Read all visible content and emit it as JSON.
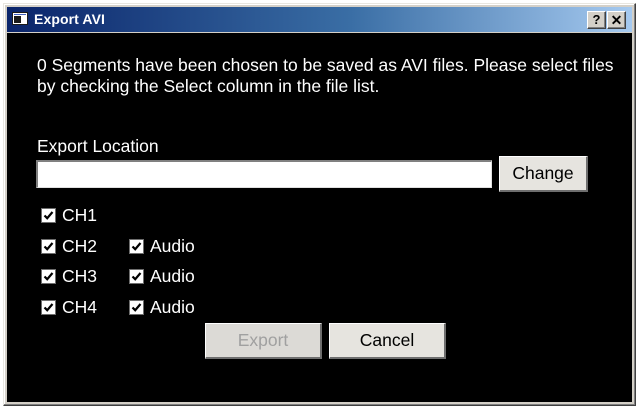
{
  "window": {
    "title": "Export AVI",
    "help_button": "?",
    "close_button": "✕"
  },
  "message": "0 Segments have been chosen to be saved as AVI files. Please select files by checking the Select column in the file list.",
  "export_location": {
    "label": "Export Location",
    "value": "",
    "change_label": "Change"
  },
  "channels": [
    {
      "label": "CH1",
      "checked": true
    },
    {
      "label": "CH2",
      "checked": true,
      "audio_label": "Audio",
      "audio_checked": true
    },
    {
      "label": "CH3",
      "checked": true,
      "audio_label": "Audio",
      "audio_checked": true
    },
    {
      "label": "CH4",
      "checked": true,
      "audio_label": "Audio",
      "audio_checked": true
    }
  ],
  "buttons": {
    "export_label": "Export",
    "export_enabled": false,
    "cancel_label": "Cancel"
  },
  "colors": {
    "titlebar_start": "#0a246a",
    "titlebar_end": "#a6caf0",
    "client_background": "#000000"
  }
}
